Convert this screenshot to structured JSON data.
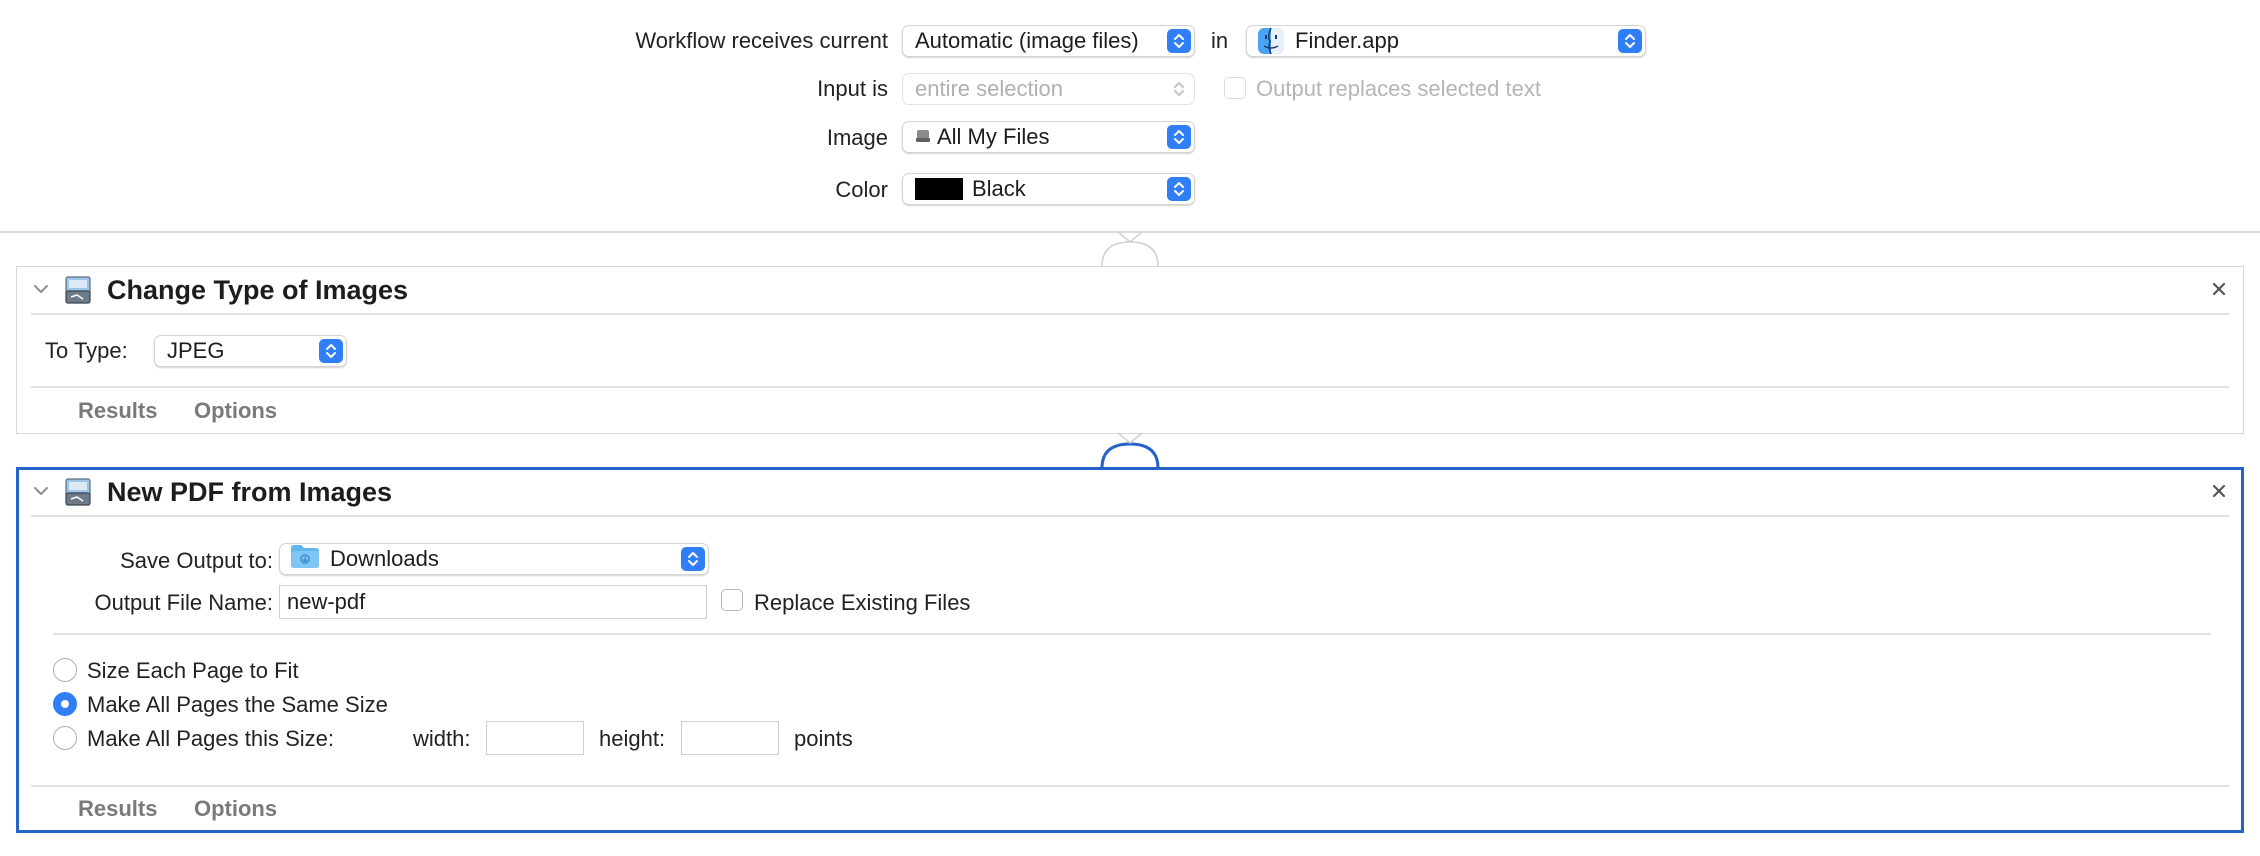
{
  "workflow": {
    "receives_label": "Workflow receives current",
    "receives_value": "Automatic (image files)",
    "in_label": "in",
    "app_value": "Finder.app",
    "input_is_label": "Input is",
    "input_is_value": "entire selection",
    "output_replaces_label": "Output replaces selected text",
    "image_label": "Image",
    "image_value": "All My Files",
    "color_label": "Color",
    "color_value": "Black",
    "color_swatch": "#000000"
  },
  "actions": [
    {
      "title": "Change Type of Images",
      "icon": "image-converter-icon",
      "to_type_label": "To Type:",
      "to_type_value": "JPEG",
      "tabs": [
        "Results",
        "Options"
      ]
    },
    {
      "title": "New PDF from Images",
      "icon": "image-converter-icon",
      "save_output_label": "Save Output to:",
      "save_output_value": "Downloads",
      "folder_icon": "folder-icon",
      "file_name_label": "Output File Name:",
      "file_name_value": "new-pdf",
      "replace_label": "Replace Existing Files",
      "radio_options": [
        {
          "label": "Size Each Page to Fit",
          "selected": false
        },
        {
          "label": "Make All Pages the Same Size",
          "selected": true
        },
        {
          "label": "Make All Pages this Size:",
          "selected": false
        }
      ],
      "width_label": "width:",
      "height_label": "height:",
      "points_label": "points",
      "tabs": [
        "Results",
        "Options"
      ]
    }
  ],
  "colors": {
    "accent": "#2f7ef5",
    "selection_border": "#2563c9"
  }
}
